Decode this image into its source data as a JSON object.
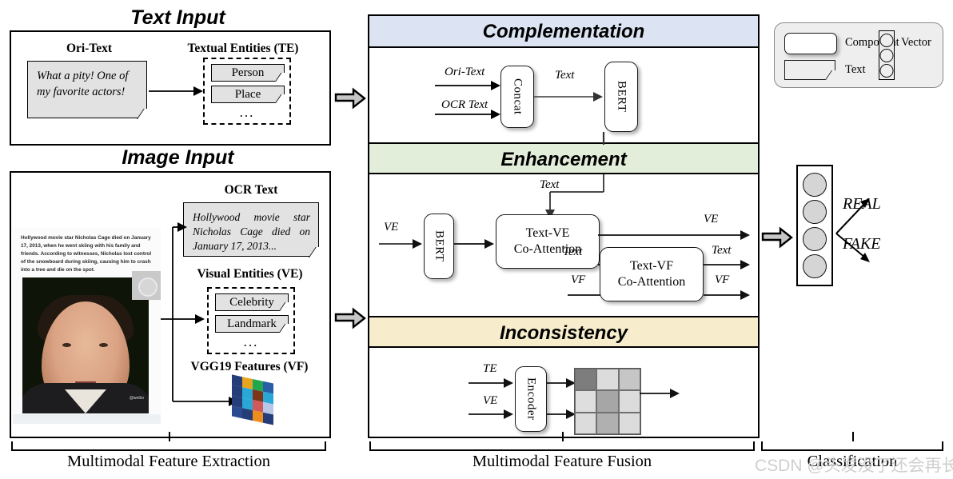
{
  "left_panel": {
    "text_input_title": "Text Input",
    "image_input_title": "Image Input",
    "ori_text_heading": "Ori-Text",
    "ori_text_content": "What a pity!  One of my favorite  actors!",
    "textual_entities_heading": "Textual Entities (TE)",
    "textual_entities": [
      "Person",
      "Place"
    ],
    "entities_ellipsis": "...",
    "ocr_heading": "OCR Text",
    "ocr_content": "Hollywood  movie  star Nicholas  Cage  died  on January 17, 2013...",
    "visual_entities_heading": "Visual Entities (VE)",
    "visual_entities": [
      "Celebrity",
      "Landmark"
    ],
    "visual_ellipsis": "...",
    "vgg_heading": "VGG19 Features (VF)",
    "news_snippet": "Hollywood movie star Nicholas Cage died on January 17, 2013, when he went skiing with his family and friends. According to witnesses, Nicholas lost control of the snowboard during skiing, causing him to crash into a tree and die on the spot.",
    "bracket_label": "Multimodal Feature Extraction"
  },
  "fusion_panel": {
    "bracket_label": "Multimodal Feature Fusion",
    "complementation": {
      "band_title": "Complementation",
      "band_color": "#dce3f2",
      "input_top": "Ori-Text",
      "input_bottom": "OCR Text",
      "concat_block": "Concat",
      "middle_label": "Text",
      "bert_block": "BERT"
    },
    "enhancement": {
      "band_title": "Enhancement",
      "band_color": "#e2eed9",
      "input_ve": "VE",
      "bert_block": "BERT",
      "text_input_label": "Text",
      "co_attention_1": "Text-VE\nCo-Attention",
      "co_attention_1_line1": "Text-VE",
      "co_attention_1_line2": "Co-Attention",
      "co_attention_2_line1": "Text-VF",
      "co_attention_2_line2": "Co-Attention",
      "out_ve": "VE",
      "mid_text": "Text",
      "in_vf": "VF",
      "out_text": "Text",
      "out_vf": "VF"
    },
    "inconsistency": {
      "band_title": "Inconsistency",
      "band_color": "#f7edcd",
      "input_te": "TE",
      "input_ve": "VE",
      "encoder_block": "Encoder",
      "matrix_cells": [
        "#7d7d7d",
        "#dcdcdc",
        "#c6c6c6",
        "#dedede",
        "#a6a6a6",
        "#dcdcdc",
        "#dcdcdc",
        "#b0b0b0",
        "#dcdcdc"
      ]
    }
  },
  "classification_panel": {
    "bracket_label": "Classification",
    "outputs": [
      "REAL",
      "FAKE"
    ]
  },
  "legend": {
    "component_label": "Component",
    "text_label": "Text",
    "vector_label": "Vector"
  },
  "watermark": "CSDN @头发没了还会再长"
}
